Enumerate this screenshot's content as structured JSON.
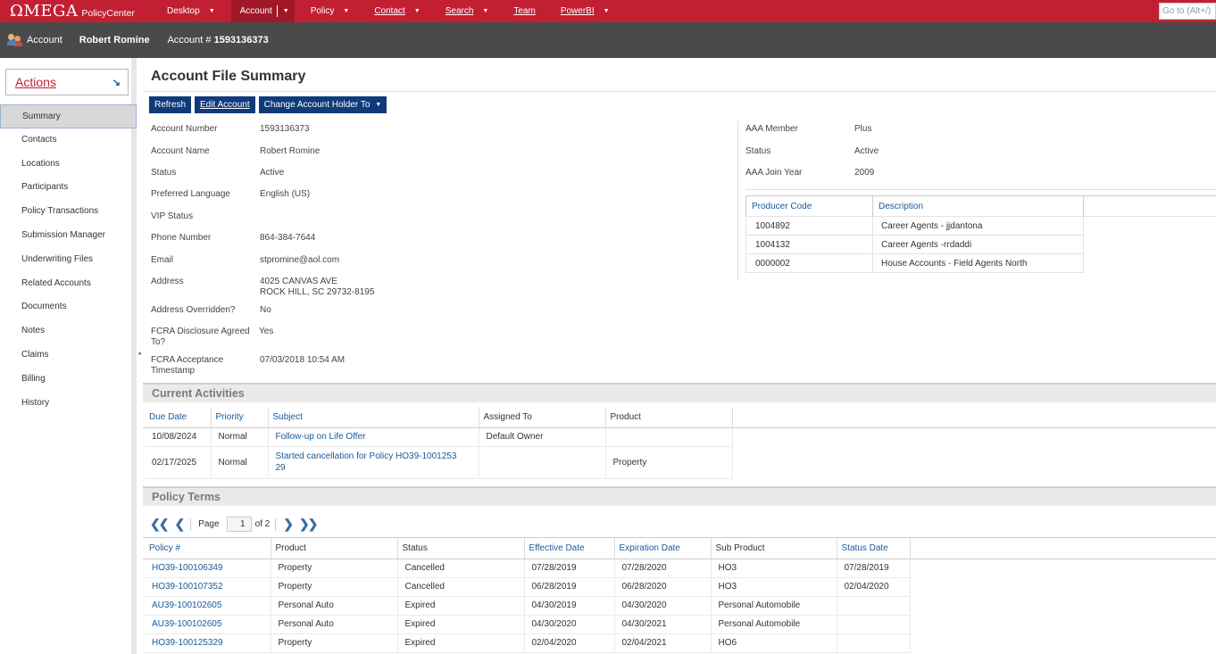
{
  "topbar": {
    "logo": "ΩMEGA",
    "product": "PolicyCenter",
    "menu": [
      {
        "label": "Desktop"
      },
      {
        "label": "Account"
      },
      {
        "label": "Policy"
      },
      {
        "label": "Contact"
      },
      {
        "label": "Search"
      },
      {
        "label": "Team"
      },
      {
        "label": "PowerBI"
      }
    ],
    "goto_placeholder": "Go to (Alt+/)"
  },
  "infobar": {
    "label": "Account",
    "holder": "Robert Romine",
    "acct_prefix": "Account #",
    "acct_number": "1593136373"
  },
  "sidebar": {
    "actions_label": "Actions",
    "items": [
      "Summary",
      "Contacts",
      "Locations",
      "Participants",
      "Policy Transactions",
      "Submission Manager",
      "Underwriting Files",
      "Related Accounts",
      "Documents",
      "Notes",
      "Claims",
      "Billing",
      "History"
    ]
  },
  "main": {
    "title": "Account File Summary",
    "buttons": {
      "refresh": "Refresh",
      "edit": "Edit Account",
      "change": "Change Account Holder To"
    },
    "fields": [
      {
        "k": "Account Number",
        "v": "1593136373"
      },
      {
        "k": "Account Name",
        "v": "Robert Romine"
      },
      {
        "k": "Status",
        "v": "Active"
      },
      {
        "k": "Preferred Language",
        "v": "English (US)"
      },
      {
        "k": "VIP Status",
        "v": ""
      },
      {
        "k": "Phone Number",
        "v": "864-384-7644"
      },
      {
        "k": "Email",
        "v": "stpromine@aol.com"
      },
      {
        "k": "Address",
        "v": "4025 CANVAS AVE",
        "v2": "ROCK HILL, SC 29732-8195"
      },
      {
        "k": "Address Overridden?",
        "v": "No"
      },
      {
        "k": "FCRA Disclosure Agreed",
        "k2": "To?",
        "v": "Yes"
      },
      {
        "k": "FCRA Acceptance",
        "k2": "Timestamp",
        "v": "07/03/2018 10:54 AM"
      }
    ],
    "right_fields": [
      {
        "k": "AAA Member",
        "v": "Plus"
      },
      {
        "k": "Status",
        "v": "Active"
      },
      {
        "k": "AAA Join Year",
        "v": "2009"
      }
    ],
    "producers": {
      "headers": [
        "Producer Code",
        "Description"
      ],
      "rows": [
        [
          "1004892",
          "Career Agents - jjdantona"
        ],
        [
          "1004132",
          "Career Agents -rrdaddi"
        ],
        [
          "0000002",
          "House Accounts - Field Agents North"
        ]
      ]
    },
    "activities": {
      "title": "Current Activities",
      "headers": [
        "Due Date",
        "Priority",
        "Subject",
        "Assigned To",
        "Product"
      ],
      "rows": [
        [
          "10/08/2024",
          "Normal",
          "Follow-up on Life Offer",
          "Default Owner",
          ""
        ],
        [
          "02/17/2025",
          "Normal",
          "Started cancellation for Policy HO39-1001253",
          "",
          "Property"
        ]
      ],
      "subject_wrap": "29"
    },
    "policy_terms": {
      "title": "Policy Terms",
      "pager": {
        "page_label": "Page",
        "page": "1",
        "of": "of 2"
      },
      "headers": [
        "Policy #",
        "Product",
        "Status",
        "Effective Date",
        "Expiration Date",
        "Sub Product",
        "Status Date"
      ],
      "rows": [
        [
          "HO39-100106349",
          "Property",
          "Cancelled",
          "07/28/2019",
          "07/28/2020",
          "HO3",
          "07/28/2019"
        ],
        [
          "HO39-100107352",
          "Property",
          "Cancelled",
          "06/28/2019",
          "06/28/2020",
          "HO3",
          "02/04/2020"
        ],
        [
          "AU39-100102605",
          "Personal Auto",
          "Expired",
          "04/30/2019",
          "04/30/2020",
          "Personal Automobile",
          ""
        ],
        [
          "AU39-100102605",
          "Personal Auto",
          "Expired",
          "04/30/2020",
          "04/30/2021",
          "Personal Automobile",
          ""
        ],
        [
          "HO39-100125329",
          "Property",
          "Expired",
          "02/04/2020",
          "02/04/2021",
          "HO6",
          ""
        ]
      ]
    }
  }
}
